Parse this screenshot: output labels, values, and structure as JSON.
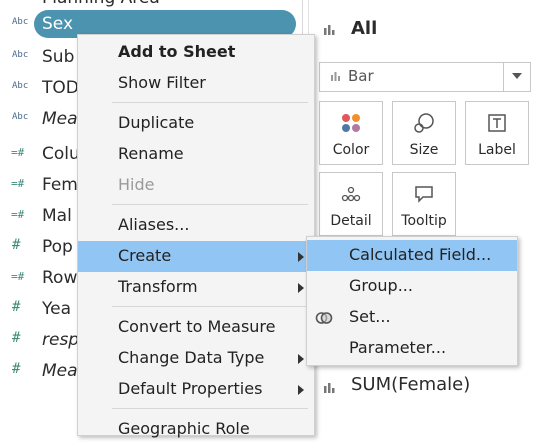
{
  "data_pane": {
    "top_partial_label": "Planning Area",
    "fields": [
      {
        "type_badge": "Abc",
        "label": "Sex",
        "italic": false,
        "selected": true
      },
      {
        "type_badge": "Abc",
        "label": "Sub",
        "italic": false,
        "selected": false
      },
      {
        "type_badge": "Abc",
        "label": "TOD",
        "italic": false,
        "selected": false
      },
      {
        "type_badge": "Abc",
        "label": "Mea",
        "italic": true,
        "selected": false
      },
      {
        "type_badge": "=#",
        "label": "Colu",
        "italic": false,
        "selected": false
      },
      {
        "type_badge": "=#",
        "label": "Fem",
        "italic": false,
        "selected": false
      },
      {
        "type_badge": "=#",
        "label": "Mal",
        "italic": false,
        "selected": false
      },
      {
        "type_badge": "#",
        "label": "Pop",
        "italic": false,
        "selected": false
      },
      {
        "type_badge": "=#",
        "label": "Row",
        "italic": false,
        "selected": false
      },
      {
        "type_badge": "#",
        "label": "Yea",
        "italic": false,
        "selected": false
      },
      {
        "type_badge": "#",
        "label": "resp",
        "italic": true,
        "selected": false
      },
      {
        "type_badge": "#",
        "label": "Mea",
        "italic": true,
        "selected": false
      }
    ]
  },
  "marks": {
    "title": "All",
    "mark_type": "Bar",
    "cards": {
      "color": "Color",
      "size": "Size",
      "label": "Label",
      "detail": "Detail",
      "tooltip": "Tooltip"
    },
    "sum_field": "SUM(Female)"
  },
  "context_menu": {
    "add_to_sheet": "Add to Sheet",
    "show_filter": "Show Filter",
    "duplicate": "Duplicate",
    "rename": "Rename",
    "hide": "Hide",
    "aliases": "Aliases...",
    "create": "Create",
    "transform": "Transform",
    "convert_to_measure": "Convert to Measure",
    "change_data_type": "Change Data Type",
    "default_properties": "Default Properties",
    "geographic_role": "Geographic Role"
  },
  "create_submenu": {
    "calculated_field": "Calculated Field...",
    "group": "Group...",
    "set": "Set...",
    "parameter": "Parameter..."
  },
  "colors": {
    "selection_pill": "#4b93af",
    "menu_highlight": "#91c6f4",
    "menu_bg": "#f4f4f4"
  }
}
